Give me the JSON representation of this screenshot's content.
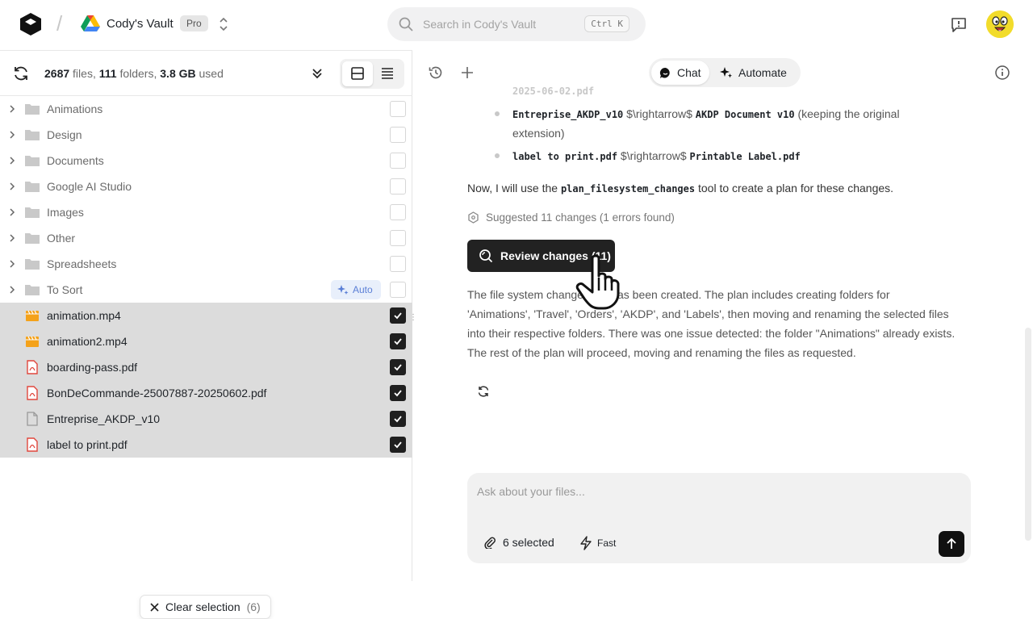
{
  "header": {
    "vault_name": "Cody's Vault",
    "plan_badge": "Pro",
    "search_placeholder": "Search in Cody's Vault",
    "search_shortcut": "Ctrl K"
  },
  "stats": {
    "files_count": "2687",
    "files_label": " files, ",
    "folders_count": "111",
    "folders_label": " folders, ",
    "size": "3.8 GB",
    "size_label": " used"
  },
  "tree": {
    "folders": [
      {
        "label": "Animations"
      },
      {
        "label": "Design"
      },
      {
        "label": "Documents"
      },
      {
        "label": "Google AI Studio"
      },
      {
        "label": "Images"
      },
      {
        "label": "Other"
      },
      {
        "label": "Spreadsheets"
      },
      {
        "label": "To Sort",
        "badge": "Auto"
      }
    ],
    "files": [
      {
        "label": "animation.mp4",
        "icon": "video-icon"
      },
      {
        "label": "animation2.mp4",
        "icon": "video-icon"
      },
      {
        "label": "boarding-pass.pdf",
        "icon": "pdf-icon"
      },
      {
        "label": "BonDeCommande-25007887-20250602.pdf",
        "icon": "pdf-icon"
      },
      {
        "label": "Entreprise_AKDP_v10",
        "icon": "file-icon"
      },
      {
        "label": "label to print.pdf",
        "icon": "pdf-icon"
      }
    ]
  },
  "clear_selection": {
    "label": "Clear selection",
    "count": "(6)"
  },
  "chat": {
    "mode_chat": "Chat",
    "mode_automate": "Automate",
    "faded_line": "2025-06-02.pdf",
    "bullet1_code": "Entreprise_AKDP_v10",
    "bullet1_arrow": " $\\rightarrow$ ",
    "bullet1_target": "AKDP Document v10",
    "bullet1_note": " (keeping the original",
    "bullet1_note2": "extension)",
    "bullet2_code": "label to print.pdf",
    "bullet2_arrow": " $\\rightarrow$ ",
    "bullet2_target": "Printable Label.pdf",
    "tool_line_pre": "Now, I will use the ",
    "tool_line_code": "plan_filesystem_changes",
    "tool_line_post": " tool to create a plan for these changes.",
    "suggested": "Suggested 11 changes (1 errors found)",
    "review_button": "Review changes (11)",
    "summary_l1": "The file system change plan has been created. The plan includes creating folders for",
    "summary_l2": "'Animations', 'Travel', 'Orders', 'AKDP', and 'Labels', then moving and renaming the selected files",
    "summary_l3": "into their respective folders. There was one issue detected: the folder \"Animations\" already exists.",
    "summary_l4": "The rest of the plan will proceed, moving and renaming the files as requested."
  },
  "composer": {
    "placeholder": "Ask about your files...",
    "attachments": "6 selected",
    "speed": "Fast"
  },
  "colors": {
    "accent": "#5b7fd6",
    "selected_row": "#dcdcdc",
    "dark": "#222222"
  }
}
